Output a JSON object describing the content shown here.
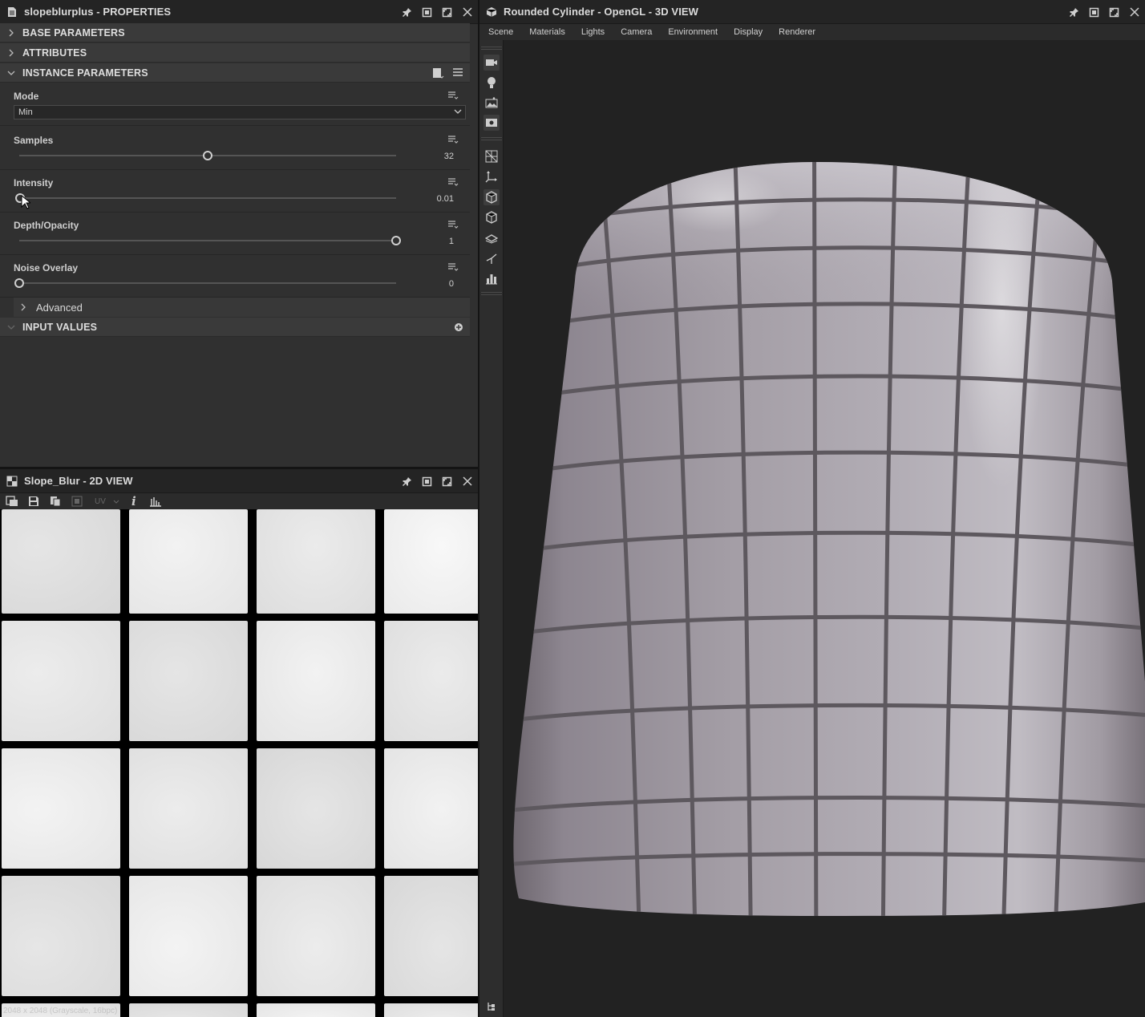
{
  "properties": {
    "title": "slopeblurplus - PROPERTIES",
    "sections": {
      "base": "BASE PARAMETERS",
      "attributes": "ATTRIBUTES",
      "instance": "INSTANCE PARAMETERS",
      "input": "INPUT VALUES"
    },
    "mode": {
      "label": "Mode",
      "value": "Min"
    },
    "samples": {
      "label": "Samples",
      "value": "32",
      "fraction": 0.5
    },
    "intensity": {
      "label": "Intensity",
      "value": "0.01",
      "fraction": 0.0
    },
    "depth": {
      "label": "Depth/Opacity",
      "value": "1",
      "fraction": 1.0
    },
    "noise": {
      "label": "Noise Overlay",
      "value": "0",
      "fraction": 0.0
    },
    "advanced": "Advanced"
  },
  "view2d": {
    "title": "Slope_Blur - 2D VIEW",
    "uv_label": "UV",
    "resolution_text": "2048 x 2048 (Grayscale, 16bpc)"
  },
  "view3d": {
    "title": "Rounded Cylinder - OpenGL - 3D VIEW",
    "menu": [
      "Scene",
      "Materials",
      "Lights",
      "Camera",
      "Environment",
      "Display",
      "Renderer"
    ]
  },
  "icons": {
    "pin": "pin-icon",
    "float": "float-icon",
    "maximize": "maximize-icon",
    "close": "close-icon"
  },
  "colors": {
    "panel_bg": "#303030",
    "section_bg": "#3a3a3a",
    "title_bg": "#242424",
    "tile_light": "#e6e6e6",
    "cylinder": "#a8a2aa",
    "grout": "#5e5a5e"
  }
}
